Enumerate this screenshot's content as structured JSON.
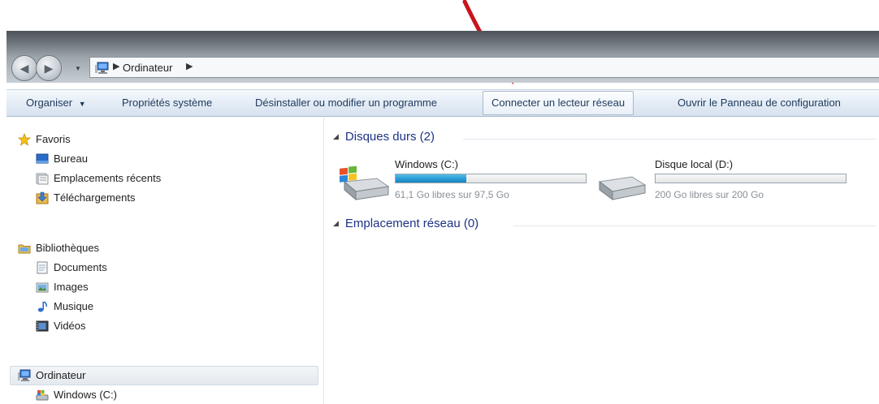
{
  "address_bar": {
    "crumb": "Ordinateur"
  },
  "toolbar": {
    "items": [
      {
        "label": "Organiser",
        "has_dropdown": true
      },
      {
        "label": "Propriétés système"
      },
      {
        "label": "Désinstaller ou modifier un programme"
      },
      {
        "label": "Connecter un lecteur réseau",
        "highlighted": true
      },
      {
        "label": "Ouvrir le Panneau de configuration"
      }
    ]
  },
  "sidebar": {
    "favorites": {
      "label": "Favoris",
      "items": [
        {
          "label": "Bureau",
          "icon": "desktop-icon"
        },
        {
          "label": "Emplacements récents",
          "icon": "recent-places-icon"
        },
        {
          "label": "Téléchargements",
          "icon": "downloads-icon"
        }
      ]
    },
    "libraries": {
      "label": "Bibliothèques",
      "items": [
        {
          "label": "Documents",
          "icon": "documents-icon"
        },
        {
          "label": "Images",
          "icon": "images-icon"
        },
        {
          "label": "Musique",
          "icon": "music-icon"
        },
        {
          "label": "Vidéos",
          "icon": "videos-icon"
        }
      ]
    },
    "computer": {
      "label": "Ordinateur",
      "selected": true,
      "items": [
        {
          "label": "Windows (C:)",
          "icon": "windows-drive-icon"
        }
      ]
    }
  },
  "content": {
    "hard_drives": {
      "header": "Disques durs (2)",
      "drives": [
        {
          "name": "Windows (C:)",
          "free_text": "61,1 Go libres sur 97,5 Go",
          "used_fraction": 0.373,
          "icon": "windows-drive-icon"
        },
        {
          "name": "Disque local (D:)",
          "free_text": "200 Go libres sur 200 Go",
          "used_fraction": 0.0,
          "icon": "hard-drive-icon"
        }
      ]
    },
    "network": {
      "header": "Emplacement réseau (0)"
    }
  },
  "colors": {
    "accent_header": "#1e3287",
    "annotation_arrow": "#c8141e",
    "usage_bar": "#2a9fd6"
  }
}
